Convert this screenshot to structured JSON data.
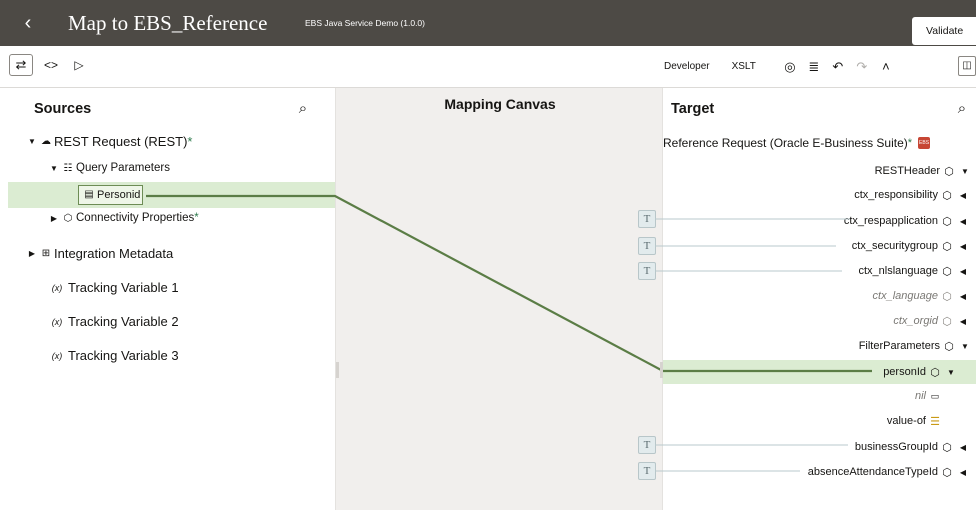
{
  "header": {
    "back_icon": "chevron-left-icon",
    "title": "Map to EBS_Reference",
    "subtitle": "EBS Java Service Demo (1.0.0)",
    "validate_label": "Validate",
    "bg_color": "#4d4a45"
  },
  "toolbar": {
    "developer_label": "Developer",
    "xslt_label": "XSLT",
    "icons": [
      "swap-icon",
      "code-icon",
      "play-icon",
      "eye-icon",
      "filter-icon",
      "undo-icon",
      "redo-icon",
      "collapse-icon",
      "panel-toggle-icon"
    ]
  },
  "sources": {
    "title": "Sources",
    "rest_request": "REST Request (REST)",
    "query_parameters": "Query Parameters",
    "personid": "Personid",
    "connectivity_properties": "Connectivity Properties",
    "integration_metadata": "Integration Metadata",
    "tracking_1": "Tracking Variable 1",
    "tracking_2": "Tracking Variable 2",
    "tracking_3": "Tracking Variable 3",
    "required_mark": "*",
    "var_prefix": "(x)"
  },
  "canvas": {
    "title": "Mapping Canvas",
    "wire_color": "#5b7d46"
  },
  "target": {
    "title": "Target",
    "root": "Reference Request (Oracle E-Business Suite)",
    "root_badge": "EBS",
    "rest_header": "RESTHeader",
    "ctx_responsibility": "ctx_responsibility",
    "ctx_respapplication": "ctx_respapplication",
    "ctx_securitygroup": "ctx_securitygroup",
    "ctx_nlslanguage": "ctx_nlslanguage",
    "ctx_language": "ctx_language",
    "ctx_orgid": "ctx_orgid",
    "filter_parameters": "FilterParameters",
    "personid": "personId",
    "nil": "nil",
    "value_of": "value-of",
    "business_group_id": "businessGroupId",
    "absence_attendance_type_id": "absenceAttendanceTypeId",
    "t_label": "T"
  }
}
